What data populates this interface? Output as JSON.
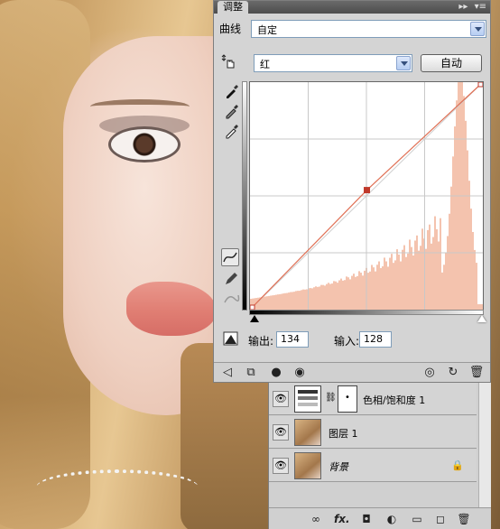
{
  "panel": {
    "tab_title": "调整",
    "title_controls": {
      "collapse": "▸▸",
      "menu": "▾≡"
    },
    "preset_label": "曲线",
    "preset_value": "自定",
    "channel_value": "红",
    "auto_label": "自动",
    "output_label": "输出:",
    "output_value": "134",
    "input_label": "输入:",
    "input_value": "128"
  },
  "curve": {
    "channel_color": "#e07055",
    "histogram_color": "#f4c3ae",
    "control_point": {
      "input": 128,
      "output": 134
    },
    "endpoints": [
      [
        0,
        0
      ],
      [
        255,
        255
      ]
    ]
  },
  "tools": [
    "hand-adjust-icon",
    "eyedropper-black-icon",
    "eyedropper-gray-icon",
    "eyedropper-white-icon",
    "curve-point-icon",
    "pencil-icon",
    "smooth-icon",
    "clip-warning-icon"
  ],
  "bottom_bar": [
    "back-arrow-icon",
    "clip-to-layer-icon",
    "visibility-toggle-icon",
    "eye-icon",
    "preview-icon",
    "reset-icon",
    "delete-icon"
  ],
  "layers": [
    {
      "name": "色相/饱和度 1",
      "type": "adjustment",
      "mask_symbol": "•"
    },
    {
      "name": "图层 1",
      "type": "pixel"
    },
    {
      "name": "背景",
      "type": "background",
      "locked": true
    }
  ],
  "layers_footer": [
    "link-icon",
    "fx-icon",
    "mask-icon",
    "adjustment-icon",
    "folder-icon",
    "new-layer-icon",
    "trash-icon"
  ],
  "layers_footer_text": {
    "fx": "fx."
  }
}
